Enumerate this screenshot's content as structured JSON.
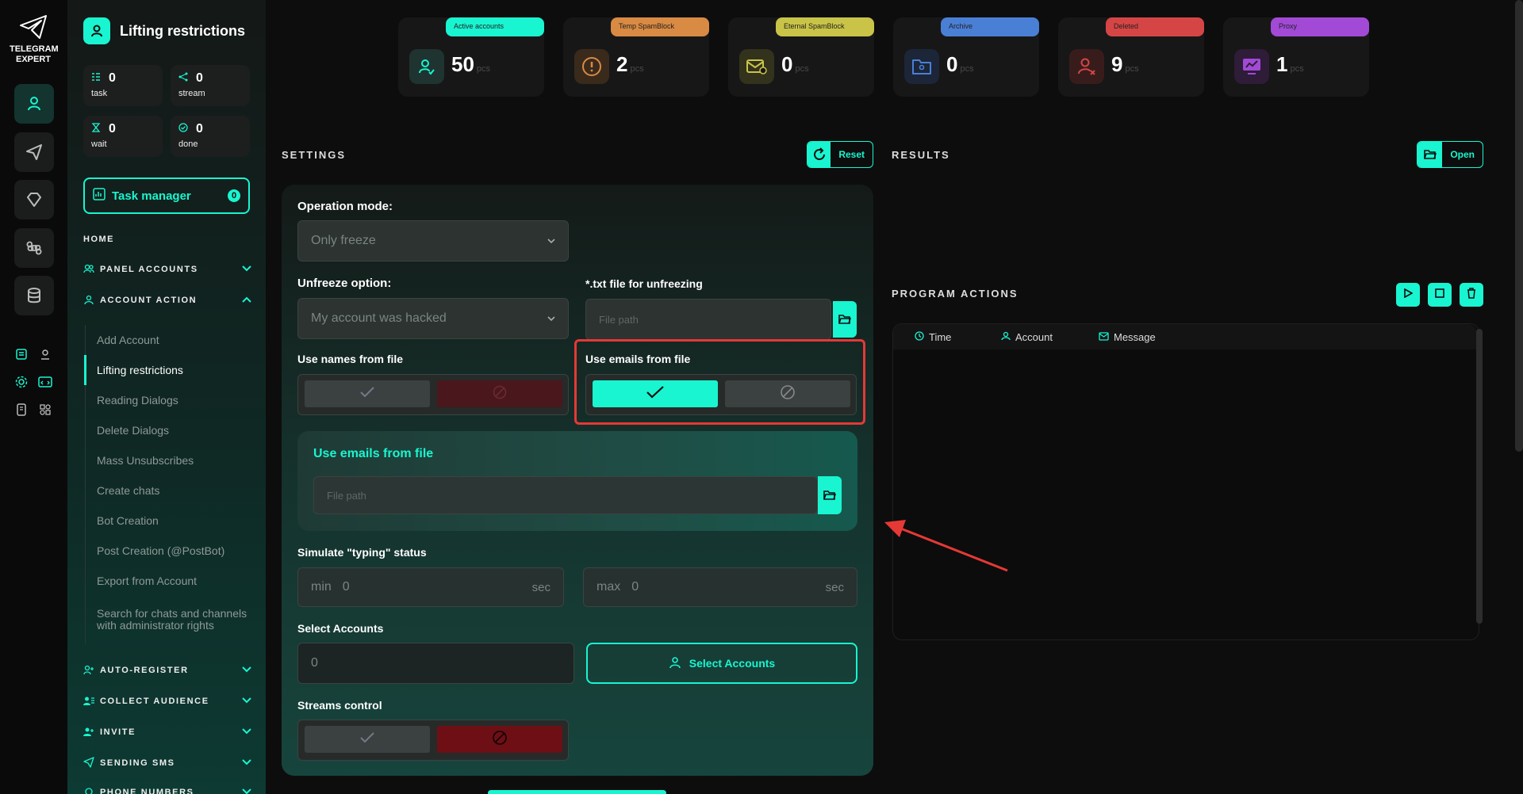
{
  "app": {
    "logo_text_1": "TELEGRAM",
    "logo_text_2": "EXPERT"
  },
  "sidebar": {
    "title": "Lifting restrictions",
    "stats": [
      {
        "value": "0",
        "label": "task",
        "icon": "task-icon"
      },
      {
        "value": "0",
        "label": "stream",
        "icon": "stream-icon"
      },
      {
        "value": "0",
        "label": "wait",
        "icon": "hourglass-icon"
      },
      {
        "value": "0",
        "label": "done",
        "icon": "check-circle-icon"
      }
    ],
    "task_manager": {
      "label": "Task manager",
      "count": "0"
    },
    "home": "HOME",
    "groups": [
      {
        "label": "PANEL ACCOUNTS",
        "icon": "users-icon",
        "expanded": false
      },
      {
        "label": "ACCOUNT ACTION",
        "icon": "user-icon",
        "expanded": true
      },
      {
        "label": "AUTO-REGISTER",
        "icon": "user-plus-icon",
        "expanded": false
      },
      {
        "label": "COLLECT AUDIENCE",
        "icon": "user-list-icon",
        "expanded": false
      },
      {
        "label": "INVITE",
        "icon": "user-plus-icon",
        "expanded": false
      },
      {
        "label": "SENDING SMS",
        "icon": "send-icon",
        "expanded": false
      },
      {
        "label": "PHONE NUMBERS",
        "icon": "phone-icon",
        "expanded": false
      }
    ],
    "account_action_items": [
      "Add Account",
      "Lifting restrictions",
      "Reading Dialogs",
      "Delete Dialogs",
      "Mass Unsubscribes",
      "Create chats",
      "Bot Creation",
      "Post Creation (@PostBot)",
      "Export from Account",
      "Search for chats and channels with administrator rights"
    ],
    "active_item": "Lifting restrictions"
  },
  "top_stats": [
    {
      "tag": "Active accounts",
      "value": "50",
      "unit": "pcs",
      "color": "#19f5d0",
      "icon": "user-check-icon"
    },
    {
      "tag": "Temp SpamBlock",
      "value": "2",
      "unit": "pcs",
      "color": "#d98a43",
      "icon": "alert-icon"
    },
    {
      "tag": "Eternal SpamBlock",
      "value": "0",
      "unit": "pcs",
      "color": "#c9c447",
      "icon": "mail-block-icon"
    },
    {
      "tag": "Archive",
      "value": "0",
      "unit": "pcs",
      "color": "#4a7fd6",
      "icon": "archive-folder-icon"
    },
    {
      "tag": "Deleted",
      "value": "9",
      "unit": "pcs",
      "color": "#d64545",
      "icon": "user-x-icon"
    },
    {
      "tag": "Proxy",
      "value": "1",
      "unit": "pcs",
      "color": "#a24ad6",
      "icon": "proxy-icon"
    }
  ],
  "settings": {
    "title": "SETTINGS",
    "reset_label": "Reset",
    "operation_mode": {
      "label": "Operation mode:",
      "value": "Only freeze"
    },
    "unfreeze_option": {
      "label": "Unfreeze option:",
      "value": "My account was hacked"
    },
    "txt_file": {
      "label": "*.txt file for unfreezing",
      "placeholder": "File path"
    },
    "use_names": {
      "label": "Use names from file",
      "state": "off"
    },
    "use_emails": {
      "label": "Use emails from file",
      "state": "on"
    },
    "emails_card": {
      "title": "Use emails from file",
      "placeholder": "File path"
    },
    "typing": {
      "label": "Simulate \"typing\" status",
      "min_prefix": "min",
      "min_value": "0",
      "max_prefix": "max",
      "max_value": "0",
      "unit": "sec"
    },
    "select_accounts": {
      "label": "Select Accounts",
      "value": "0",
      "button": "Select Accounts"
    },
    "streams": {
      "label": "Streams control",
      "state": "off"
    }
  },
  "results": {
    "title": "RESULTS",
    "open_label": "Open",
    "program_actions": "PROGRAM ACTIONS",
    "columns": [
      "Time",
      "Account",
      "Message"
    ]
  },
  "colors": {
    "accent": "#19f5d0",
    "danger": "#e53935",
    "bg": "#0d0d0d"
  }
}
